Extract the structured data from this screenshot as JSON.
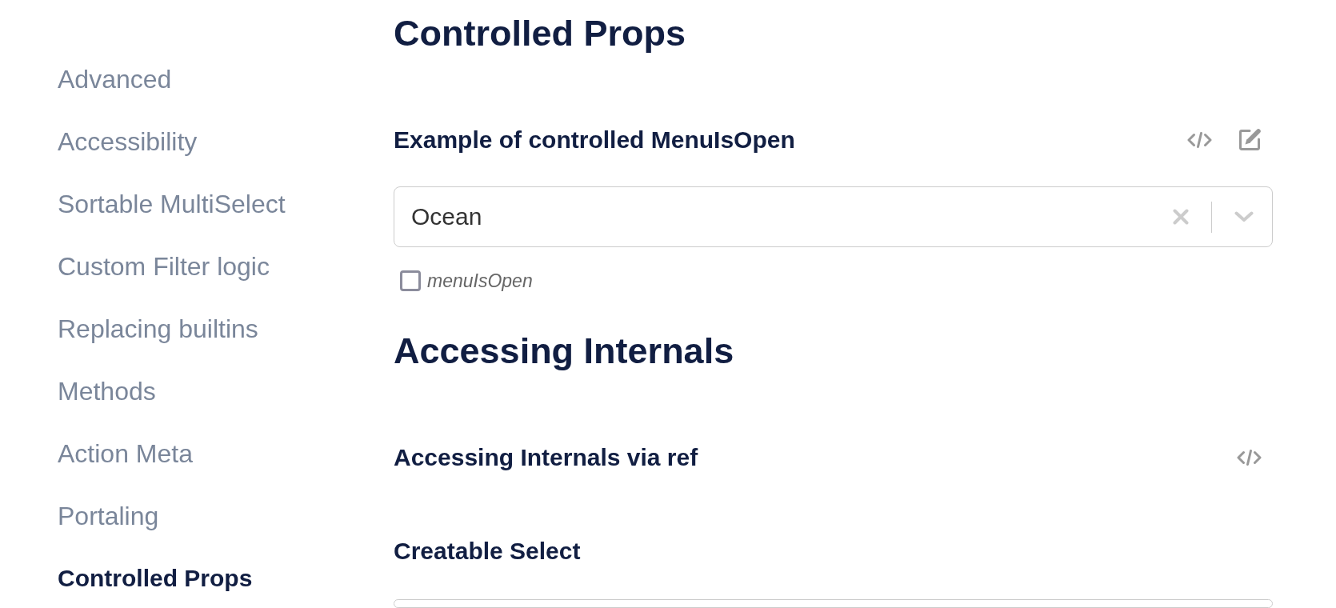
{
  "sidebar": {
    "items": [
      {
        "label": "Advanced",
        "selected": false
      },
      {
        "label": "Accessibility",
        "selected": false
      },
      {
        "label": "Sortable MultiSelect",
        "selected": false
      },
      {
        "label": "Custom Filter logic",
        "selected": false
      },
      {
        "label": "Replacing builtins",
        "selected": false
      },
      {
        "label": "Methods",
        "selected": false
      },
      {
        "label": "Action Meta",
        "selected": false
      },
      {
        "label": "Portaling",
        "selected": false
      },
      {
        "label": "Controlled Props",
        "selected": true
      }
    ]
  },
  "sections": [
    {
      "title": "Controlled Props",
      "examples": [
        {
          "title": "Example of controlled MenuIsOpen",
          "source_link": true,
          "edit_link": true,
          "select": {
            "value": "Ocean",
            "focused": false
          },
          "checkbox": {
            "label": "menuIsOpen",
            "checked": false
          }
        }
      ]
    },
    {
      "title": "Accessing Internals",
      "examples": [
        {
          "title": "Accessing Internals via ref",
          "source_link": true
        },
        {
          "title": "Creatable Select",
          "select": {
            "focused": false
          }
        }
      ]
    }
  ]
}
